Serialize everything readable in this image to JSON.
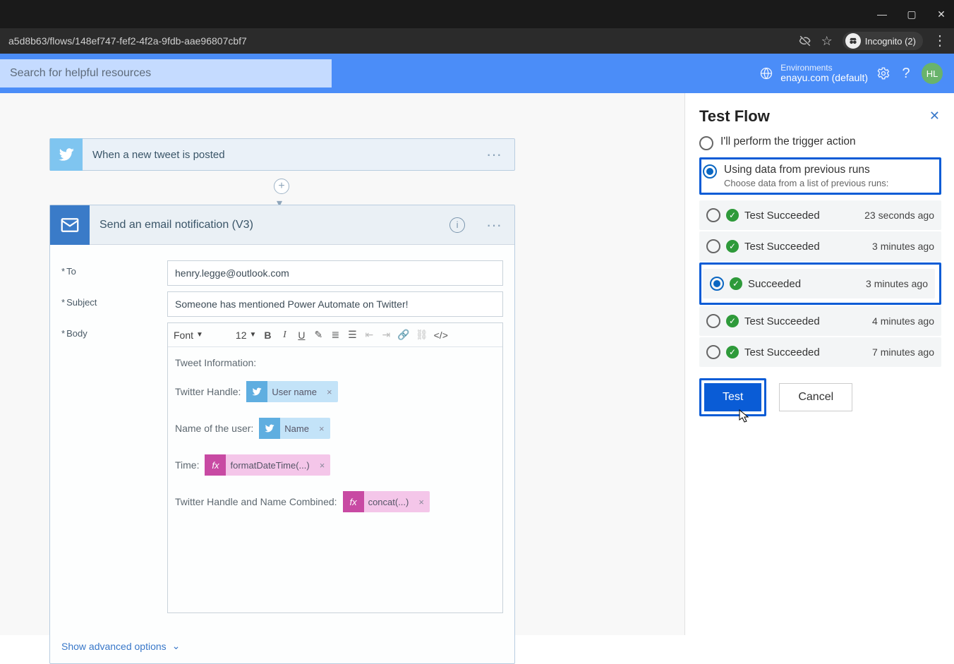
{
  "browser": {
    "url": "a5d8b63/flows/148ef747-fef2-4f2a-9fdb-aae96807cbf7",
    "incognito_label": "Incognito (2)"
  },
  "header": {
    "search_placeholder": "Search for helpful resources",
    "env_label": "Environments",
    "env_value": "enayu.com (default)",
    "avatar": "HL"
  },
  "trigger": {
    "title": "When a new tweet is posted"
  },
  "action": {
    "title": "Send an email notification (V3)",
    "fields": {
      "to_label": "To",
      "to_value": "henry.legge@outlook.com",
      "subject_label": "Subject",
      "subject_value": "Someone has mentioned Power Automate on Twitter!",
      "body_label": "Body"
    },
    "toolbar": {
      "font_label": "Font",
      "size_label": "12"
    },
    "body": {
      "info_heading": "Tweet Information:",
      "handle_label": "Twitter Handle:",
      "handle_token": "User name",
      "name_label": "Name of the user:",
      "name_token": "Name",
      "time_label": "Time:",
      "time_token": "formatDateTime(...)",
      "combined_label": "Twitter Handle and Name Combined:",
      "combined_token": "concat(...)"
    },
    "advanced_label": "Show advanced options"
  },
  "panel": {
    "title": "Test Flow",
    "opt_manual": "I'll perform the trigger action",
    "opt_previous": "Using data from previous runs",
    "opt_previous_sub": "Choose data from a list of previous runs:",
    "runs": [
      {
        "label": "Test Succeeded",
        "time": "23 seconds ago",
        "selected": false
      },
      {
        "label": "Test Succeeded",
        "time": "3 minutes ago",
        "selected": false
      },
      {
        "label": "Succeeded",
        "time": "3 minutes ago",
        "selected": true
      },
      {
        "label": "Test Succeeded",
        "time": "4 minutes ago",
        "selected": false
      },
      {
        "label": "Test Succeeded",
        "time": "7 minutes ago",
        "selected": false
      }
    ],
    "test_btn": "Test",
    "cancel_btn": "Cancel"
  }
}
